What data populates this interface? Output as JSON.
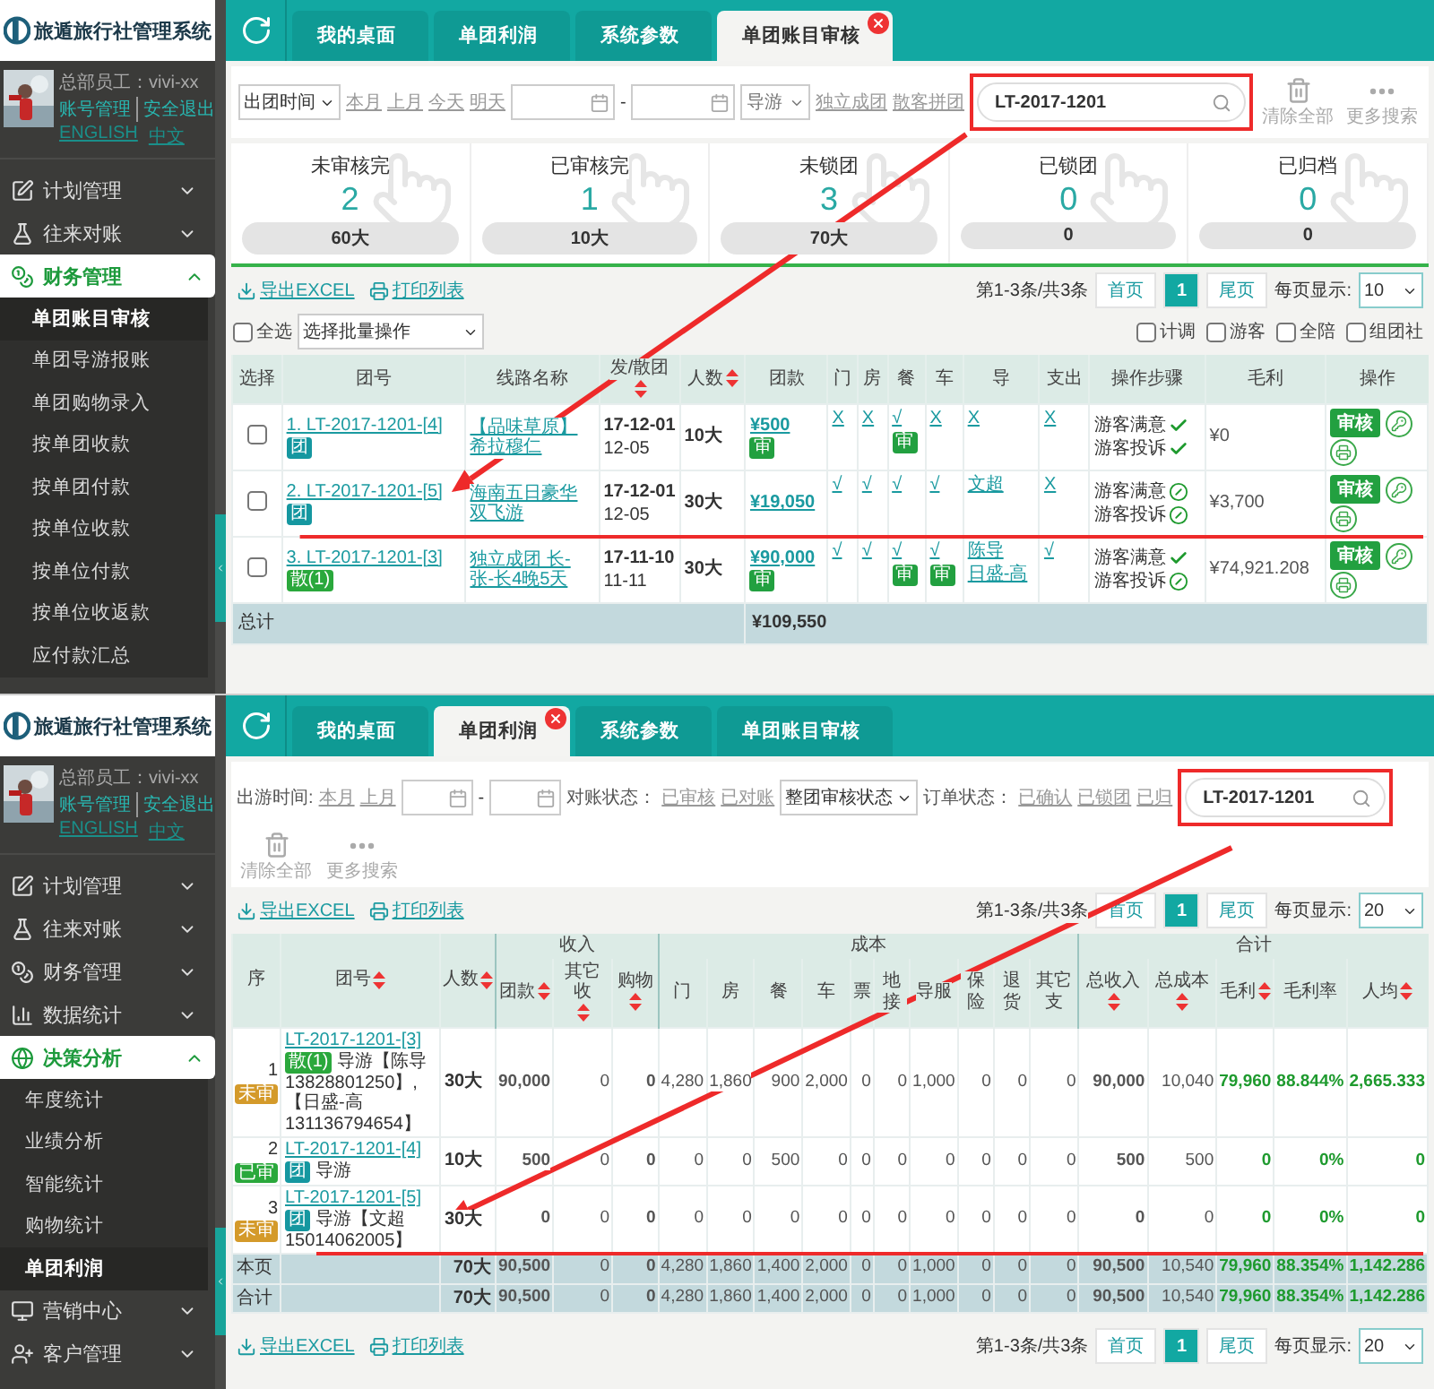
{
  "screens": [
    {
      "kind": "audit",
      "logo": {
        "title": "旅遁旅行社管理系统"
      },
      "user": {
        "role": "总部员工：vivi-xx",
        "links": [
          "账号管理",
          "安全退出"
        ],
        "languages": [
          "ENGLISH",
          "中文"
        ]
      },
      "nav": [
        {
          "label": "计划管理",
          "expanded": false
        },
        {
          "label": "往来对账",
          "expanded": false
        },
        {
          "label": "财务管理",
          "expanded": true,
          "children": [
            {
              "label": "单团账目审核",
              "selected": true
            },
            {
              "label": "单团导游报账",
              "selected": false
            },
            {
              "label": "单团购物录入",
              "selected": false
            },
            {
              "label": "按单团收款",
              "selected": false
            },
            {
              "label": "按单团付款",
              "selected": false
            },
            {
              "label": "按单位收款",
              "selected": false
            },
            {
              "label": "按单位付款",
              "selected": false
            },
            {
              "label": "按单位收返款",
              "selected": false
            },
            {
              "label": "应付款汇总",
              "selected": false
            }
          ]
        }
      ],
      "tabs": [
        {
          "label": "我的桌面",
          "selected": false
        },
        {
          "label": "单团利润",
          "selected": false
        },
        {
          "label": "系统参数",
          "selected": false
        },
        {
          "label": "单团账目审核",
          "selected": true
        }
      ],
      "filters": {
        "date_select": "出团时间",
        "date_links": [
          "本月",
          "上月",
          "今天",
          "明天"
        ],
        "range_separator": "-",
        "guide_select": "导游",
        "type_links": [
          "独立成团",
          "散客拼团"
        ],
        "search": {
          "value": "LT-2017-1201"
        },
        "actions": [
          "清除全部",
          "更多搜索"
        ]
      },
      "stats": [
        {
          "label": "未审核完",
          "count": "2",
          "total": "60大"
        },
        {
          "label": "已审核完",
          "count": "1",
          "total": "10大"
        },
        {
          "label": "未锁团",
          "count": "3",
          "total": "70大"
        },
        {
          "label": "已锁团",
          "count": "0",
          "total": "0"
        },
        {
          "label": "已归档",
          "count": "0",
          "total": "0"
        }
      ],
      "toolbar": [
        "导出EXCEL",
        "打印列表"
      ],
      "pager": {
        "summary": "第1-3条/共3条",
        "first": "首页",
        "pages": [
          {
            "label": "1",
            "selected": true
          }
        ],
        "last": "尾页",
        "per_page_label": "每页显示:",
        "per_page": "10"
      },
      "batch": {
        "select_all": {
          "label": "全选",
          "checked": false
        },
        "action_select": "选择批量操作",
        "filters": [
          {
            "label": "计调",
            "checked": false
          },
          {
            "label": "游客",
            "checked": false
          },
          {
            "label": "全陪",
            "checked": false
          },
          {
            "label": "组团社",
            "checked": false
          }
        ]
      },
      "table": {
        "columns": [
          {
            "label": "选择"
          },
          {
            "label": "团号"
          },
          {
            "label": "线路名称"
          },
          {
            "label": "发/散团",
            "sortable": true
          },
          {
            "label": "人数",
            "sortable": true
          },
          {
            "label": "团款"
          },
          {
            "label": "门"
          },
          {
            "label": "房"
          },
          {
            "label": "餐"
          },
          {
            "label": "车"
          },
          {
            "label": "导"
          },
          {
            "label": "支出"
          },
          {
            "label": "操作步骤"
          },
          {
            "label": "毛利"
          },
          {
            "label": "操作"
          }
        ],
        "rows": [
          {
            "checked": false,
            "code": "1. LT-2017-1201-[4]",
            "tag": {
              "text": "团",
              "kind": "group"
            },
            "route": "【品味草原】希拉穆仁",
            "dates": [
              "17-12-01",
              "12-05"
            ],
            "people": "10大",
            "fee": {
              "text": "¥500",
              "badge": "审"
            },
            "items": [
              {
                "text": "X"
              },
              {
                "text": "X"
              },
              {
                "text": "√",
                "badge": "审"
              },
              {
                "text": "X"
              },
              {
                "text": "X"
              },
              {
                "text": "X"
              }
            ],
            "steps": [
              {
                "label": "游客满意",
                "done": true
              },
              {
                "label": "游客投诉",
                "done": true
              }
            ],
            "profit": "¥0",
            "review": "审核"
          },
          {
            "checked": false,
            "code": "2. LT-2017-1201-[5]",
            "tag": {
              "text": "团",
              "kind": "group"
            },
            "route": "海南五日豪华双飞游",
            "dates": [
              "17-12-01",
              "12-05"
            ],
            "people": "30大",
            "fee": {
              "text": "¥19,050"
            },
            "items": [
              {
                "text": "√"
              },
              {
                "text": "√"
              },
              {
                "text": "√"
              },
              {
                "text": "√"
              },
              {
                "text": "文超"
              },
              {
                "text": "X"
              }
            ],
            "steps": [
              {
                "label": "游客满意",
                "done": false
              },
              {
                "label": "游客投诉",
                "done": false
              }
            ],
            "profit": "¥3,700",
            "review": "审核"
          },
          {
            "checked": false,
            "code": "3. LT-2017-1201-[3]",
            "tag": {
              "text": "散(1)",
              "kind": "scatter"
            },
            "route": "独立成团 长-张-长4晚5天",
            "dates": [
              "17-11-10",
              "11-11"
            ],
            "people": "30大",
            "fee": {
              "text": "¥90,000",
              "badge": "审"
            },
            "items": [
              {
                "text": "√"
              },
              {
                "text": "√"
              },
              {
                "text": "√",
                "badge": "审"
              },
              {
                "text": "√",
                "badge": "审"
              },
              {
                "lines": [
                  "陈导",
                  "日盛-高"
                ]
              },
              {
                "text": "√"
              }
            ],
            "steps": [
              {
                "label": "游客满意",
                "done": true
              },
              {
                "label": "游客投诉",
                "done": false
              }
            ],
            "profit": "¥74,921.208",
            "review": "审核"
          }
        ],
        "total": {
          "label": "总计",
          "amount": "¥109,550"
        }
      }
    },
    {
      "kind": "profit",
      "logo": {
        "title": "旅遁旅行社管理系统"
      },
      "user": {
        "role": "总部员工：vivi-xx",
        "links": [
          "账号管理",
          "安全退出"
        ],
        "languages": [
          "ENGLISH",
          "中文"
        ]
      },
      "nav": [
        {
          "label": "计划管理",
          "expanded": false
        },
        {
          "label": "往来对账",
          "expanded": false
        },
        {
          "label": "财务管理",
          "expanded": false
        },
        {
          "label": "数据统计",
          "expanded": false
        },
        {
          "label": "决策分析",
          "expanded": true,
          "children": [
            {
              "label": "年度统计",
              "selected": false
            },
            {
              "label": "业绩分析",
              "selected": false
            },
            {
              "label": "智能统计",
              "selected": false
            },
            {
              "label": "购物统计",
              "selected": false
            },
            {
              "label": "单团利润",
              "selected": true
            }
          ]
        },
        {
          "label": "营销中心",
          "expanded": false
        },
        {
          "label": "客户管理",
          "expanded": false
        }
      ],
      "tabs": [
        {
          "label": "我的桌面",
          "selected": false
        },
        {
          "label": "单团利润",
          "selected": true
        },
        {
          "label": "系统参数",
          "selected": false
        },
        {
          "label": "单团账目审核",
          "selected": false
        }
      ],
      "filters": {
        "date_label": "出游时间:",
        "date_links": [
          "本月",
          "上月"
        ],
        "range_separator": "-",
        "check_label": "对账状态：",
        "check_links": [
          "已审核",
          "已对账"
        ],
        "status_select": "整团审核状态",
        "order_label": "订单状态：",
        "order_links": [
          "已确认",
          "已锁团",
          "已归"
        ],
        "search": {
          "value": "LT-2017-1201"
        },
        "actions": [
          "清除全部",
          "更多搜索"
        ]
      },
      "toolbar": [
        "导出EXCEL",
        "打印列表"
      ],
      "pager": {
        "summary": "第1-3条/共3条",
        "first": "首页",
        "pages": [
          {
            "label": "1",
            "selected": true
          }
        ],
        "last": "尾页",
        "per_page_label": "每页显示:",
        "per_page": "20"
      },
      "table": {
        "lead_columns": [
          {
            "label": "序"
          },
          {
            "label": "团号",
            "sortable": true
          },
          {
            "label": "人数",
            "sortable": true
          }
        ],
        "groups": [
          {
            "label": "收入",
            "columns": [
              {
                "label": "团款",
                "sortable": true,
                "bold": true
              },
              {
                "label": "其它收",
                "sortable": true
              },
              {
                "label": "购物",
                "sortable": true,
                "bold": true
              }
            ]
          },
          {
            "label": "成本",
            "columns": [
              {
                "label": "门"
              },
              {
                "label": "房"
              },
              {
                "label": "餐"
              },
              {
                "label": "车"
              },
              {
                "label": "票"
              },
              {
                "label": "地接"
              },
              {
                "label": "导服"
              },
              {
                "label": "保险"
              },
              {
                "label": "退货"
              },
              {
                "label": "其它支"
              }
            ]
          },
          {
            "label": "合计",
            "columns": [
              {
                "label": "总收入",
                "sortable": true,
                "bold": true
              },
              {
                "label": "总成本",
                "sortable": true
              },
              {
                "label": "毛利",
                "sortable": true,
                "bold": true,
                "positive": true
              },
              {
                "label": "毛利率",
                "bold": true,
                "positive": true
              },
              {
                "label": "人均",
                "sortable": true,
                "bold": true,
                "positive": true
              }
            ]
          }
        ],
        "rows": [
          {
            "index": "1",
            "status": {
              "text": "未审",
              "kind": "pending"
            },
            "code": "LT-2017-1201-[3]",
            "tag": {
              "text": "散(1)",
              "kind": "scatter"
            },
            "note": "导游【陈导13828801250】,【日盛-高131136794654】",
            "people": "30大",
            "values": [
              "90,000",
              "0",
              "0",
              "4,280",
              "1,860",
              "900",
              "2,000",
              "0",
              "0",
              "1,000",
              "0",
              "0",
              "0",
              "90,000",
              "10,040",
              "79,960",
              "88.844%",
              "2,665.333"
            ]
          },
          {
            "index": "2",
            "status": {
              "text": "已审",
              "kind": "approved"
            },
            "code": "LT-2017-1201-[4]",
            "tag": {
              "text": "团",
              "kind": "group"
            },
            "note": "导游",
            "people": "10大",
            "values": [
              "500",
              "0",
              "0",
              "0",
              "0",
              "500",
              "0",
              "0",
              "0",
              "0",
              "0",
              "0",
              "0",
              "500",
              "500",
              "0",
              "0%",
              "0"
            ]
          },
          {
            "index": "3",
            "status": {
              "text": "未审",
              "kind": "pending"
            },
            "code": "LT-2017-1201-[5]",
            "tag": {
              "text": "团",
              "kind": "group"
            },
            "note": "导游【文超15014062005】",
            "people": "30大",
            "values": [
              "0",
              "0",
              "0",
              "0",
              "0",
              "0",
              "0",
              "0",
              "0",
              "0",
              "0",
              "0",
              "0",
              "0",
              "0",
              "0",
              "0%",
              "0"
            ]
          }
        ],
        "summary": [
          {
            "label": "本页",
            "people": "70大",
            "values": [
              "90,500",
              "0",
              "0",
              "4,280",
              "1,860",
              "1,400",
              "2,000",
              "0",
              "0",
              "1,000",
              "0",
              "0",
              "0",
              "90,500",
              "10,540",
              "79,960",
              "88.354%",
              "1,142.286"
            ]
          },
          {
            "label": "合计",
            "people": "70大",
            "values": [
              "90,500",
              "0",
              "0",
              "4,280",
              "1,860",
              "1,400",
              "2,000",
              "0",
              "0",
              "1,000",
              "0",
              "0",
              "0",
              "90,500",
              "10,540",
              "79,960",
              "88.354%",
              "1,142.286"
            ]
          }
        ]
      },
      "bottom_toolbar": [
        "导出EXCEL",
        "打印列表"
      ],
      "bottom_pager": {
        "summary": "第1-3条/共3条",
        "first": "首页",
        "pages": [
          {
            "label": "1",
            "selected": true
          }
        ],
        "last": "尾页",
        "per_page_label": "每页显示:",
        "per_page": "20"
      }
    }
  ]
}
